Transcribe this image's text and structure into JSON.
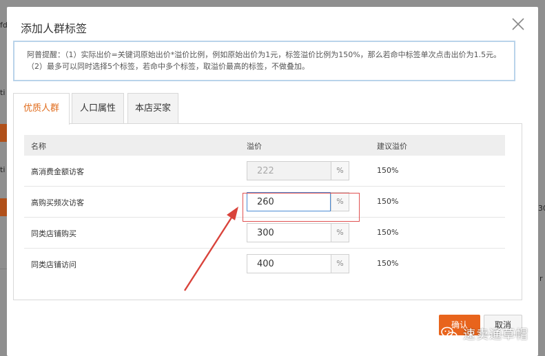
{
  "background": {
    "fragments": [
      "fdx",
      "ti",
      "ti",
      "30",
      "r"
    ]
  },
  "dialog": {
    "title": "添加人群标签",
    "tip": "阿普提醒：（1）实际出价=关键词原始出价*溢价比例，例如原始出价为1元，标签溢价比例为150%，那么若命中标签单次点击出价为1.5元。（2）最多可以同时选择5个标签，若命中多个标签，取溢价最高的标签，不做叠加。",
    "tabs": [
      {
        "label": "优质人群",
        "active": true
      },
      {
        "label": "人口属性",
        "active": false
      },
      {
        "label": "本店买家",
        "active": false
      }
    ],
    "table": {
      "headers": [
        "名称",
        "溢价",
        "建议溢价"
      ],
      "rows": [
        {
          "name": "高消费金额访客",
          "premium": "222",
          "unit": "%",
          "suggested": "150%",
          "disabled": true
        },
        {
          "name": "高购买频次访客",
          "premium": "260",
          "unit": "%",
          "suggested": "150%",
          "disabled": false,
          "focused": true
        },
        {
          "name": "同类店铺购买",
          "premium": "300",
          "unit": "%",
          "suggested": "150%",
          "disabled": false
        },
        {
          "name": "同类店铺访问",
          "premium": "400",
          "unit": "%",
          "suggested": "150%",
          "disabled": false
        }
      ]
    },
    "buttons": {
      "confirm": "确认",
      "cancel": "取消"
    }
  },
  "watermark": {
    "text": "速卖通草帽",
    "icon": "wechat-icon"
  },
  "colors": {
    "accent": "#e8641c",
    "tab_active": "#e06b1b",
    "highlight": "#e05050",
    "focus": "#4a8ad4"
  }
}
